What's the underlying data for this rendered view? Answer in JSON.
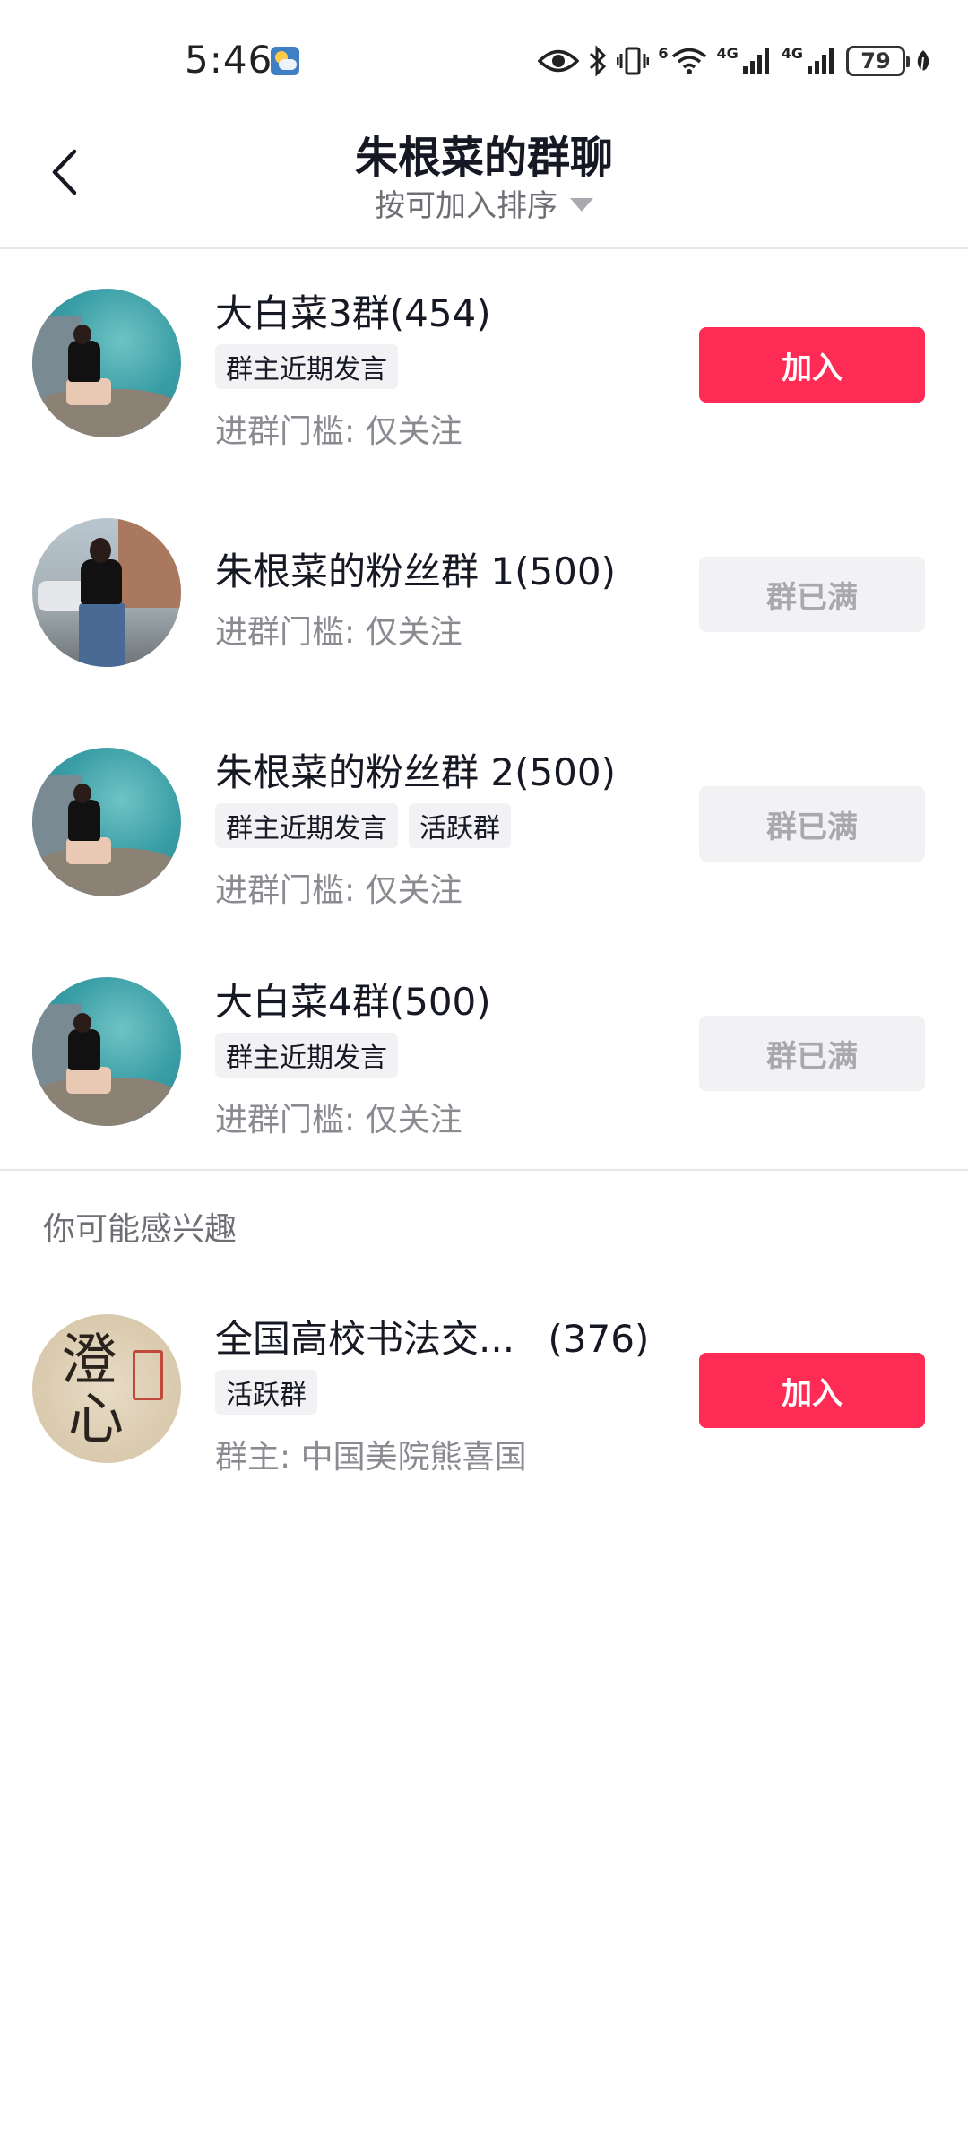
{
  "status_bar": {
    "time": "5:46",
    "net1": "4G",
    "net2": "4G",
    "battery": "79",
    "wifi_badge": "6",
    "icons": [
      "weather-icon",
      "eye-icon",
      "bluetooth-icon",
      "vibrate-icon",
      "wifi-icon",
      "signal-icon",
      "signal-icon",
      "battery-icon",
      "leaf-icon"
    ]
  },
  "header": {
    "title": "朱根菜的群聊",
    "sort_label": "按可加入排序"
  },
  "groups": [
    {
      "name": "大白菜3群(454)",
      "tags": [
        "群主近期发言"
      ],
      "threshold": "进群门槛: 仅关注",
      "action": "加入",
      "status": "join"
    },
    {
      "name": "朱根菜的粉丝群 1(500)",
      "tags": [],
      "threshold": "进群门槛: 仅关注",
      "action": "群已满",
      "status": "full"
    },
    {
      "name": "朱根菜的粉丝群 2(500)",
      "tags": [
        "群主近期发言",
        "活跃群"
      ],
      "threshold": "进群门槛: 仅关注",
      "action": "群已满",
      "status": "full"
    },
    {
      "name": "大白菜4群(500)",
      "tags": [
        "群主近期发言"
      ],
      "threshold": "进群门槛: 仅关注",
      "action": "群已满",
      "status": "full"
    }
  ],
  "recommend": {
    "section_title": "你可能感兴趣",
    "items": [
      {
        "name": "全国高校书法交...",
        "count": "(376)",
        "tags": [
          "活跃群"
        ],
        "owner": "群主: 中国美院熊喜国",
        "action": "加入",
        "avatar_glyphs": [
          "澄",
          "心"
        ]
      }
    ]
  },
  "colors": {
    "primary": "#fe2c55",
    "disabled_bg": "#f2f2f4",
    "disabled_text": "#a8a9ad",
    "secondary_text": "#8a8b91"
  }
}
